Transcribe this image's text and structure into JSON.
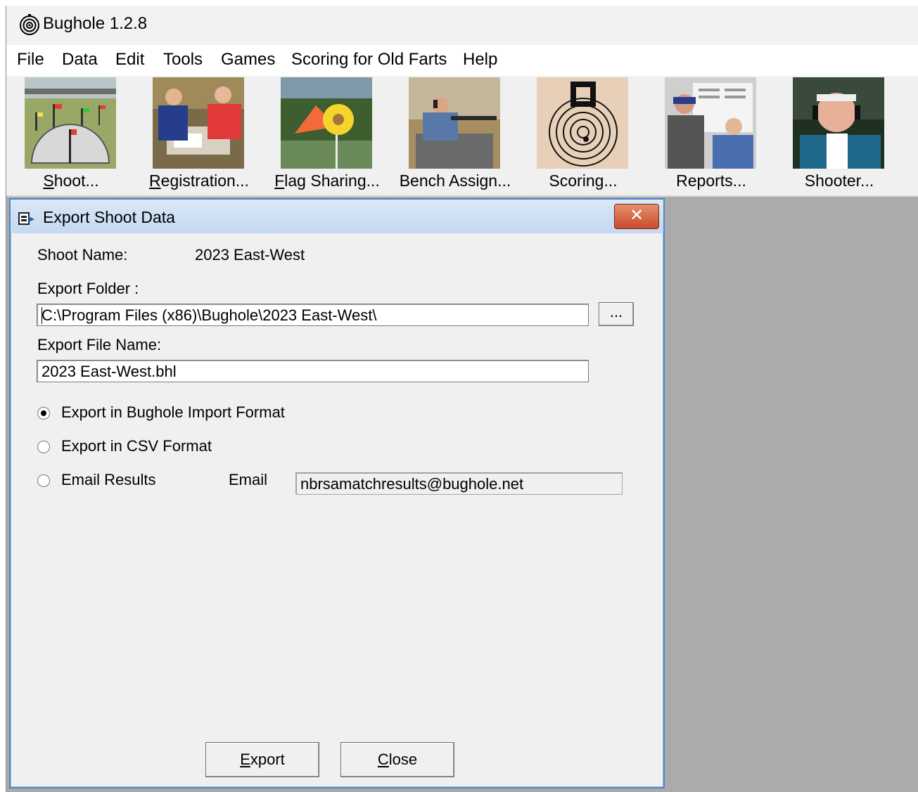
{
  "app": {
    "title": "Bughole 1.2.8"
  },
  "menu": [
    "File",
    "Data",
    "Edit",
    "Tools",
    "Games",
    "Scoring for Old Farts",
    "Help"
  ],
  "toolbar": [
    {
      "label": "Shoot...",
      "icon": "flag-range-photo"
    },
    {
      "label": "Registration...",
      "icon": "registration-photo"
    },
    {
      "label": "Flag Sharing...",
      "icon": "flag-photo"
    },
    {
      "label": "Bench Assign...",
      "icon": "bench-shooter-photo"
    },
    {
      "label": "Scoring...",
      "icon": "target-photo"
    },
    {
      "label": "Reports...",
      "icon": "reports-photo"
    },
    {
      "label": "Shooter...",
      "icon": "shooter-photo"
    }
  ],
  "dialog": {
    "title": "Export Shoot Data",
    "close_glyph": "✕",
    "shoot_name_label": "Shoot Name:",
    "shoot_name_value": "2023 East-West",
    "export_folder_label": "Export Folder :",
    "export_folder_value": "C:\\Program Files (x86)\\Bughole\\2023 East-West\\",
    "browse_label": "...",
    "export_file_label": "Export File Name:",
    "export_file_value": "2023 East-West.bhl",
    "options": [
      {
        "label": "Export in Bughole Import Format",
        "selected": true
      },
      {
        "label": "Export in CSV Format",
        "selected": false
      },
      {
        "label": "Email Results",
        "selected": false
      }
    ],
    "email_label": "Email",
    "email_value": "nbrsamatchresults@bughole.net",
    "export_button": "Export",
    "close_button": "Close"
  }
}
